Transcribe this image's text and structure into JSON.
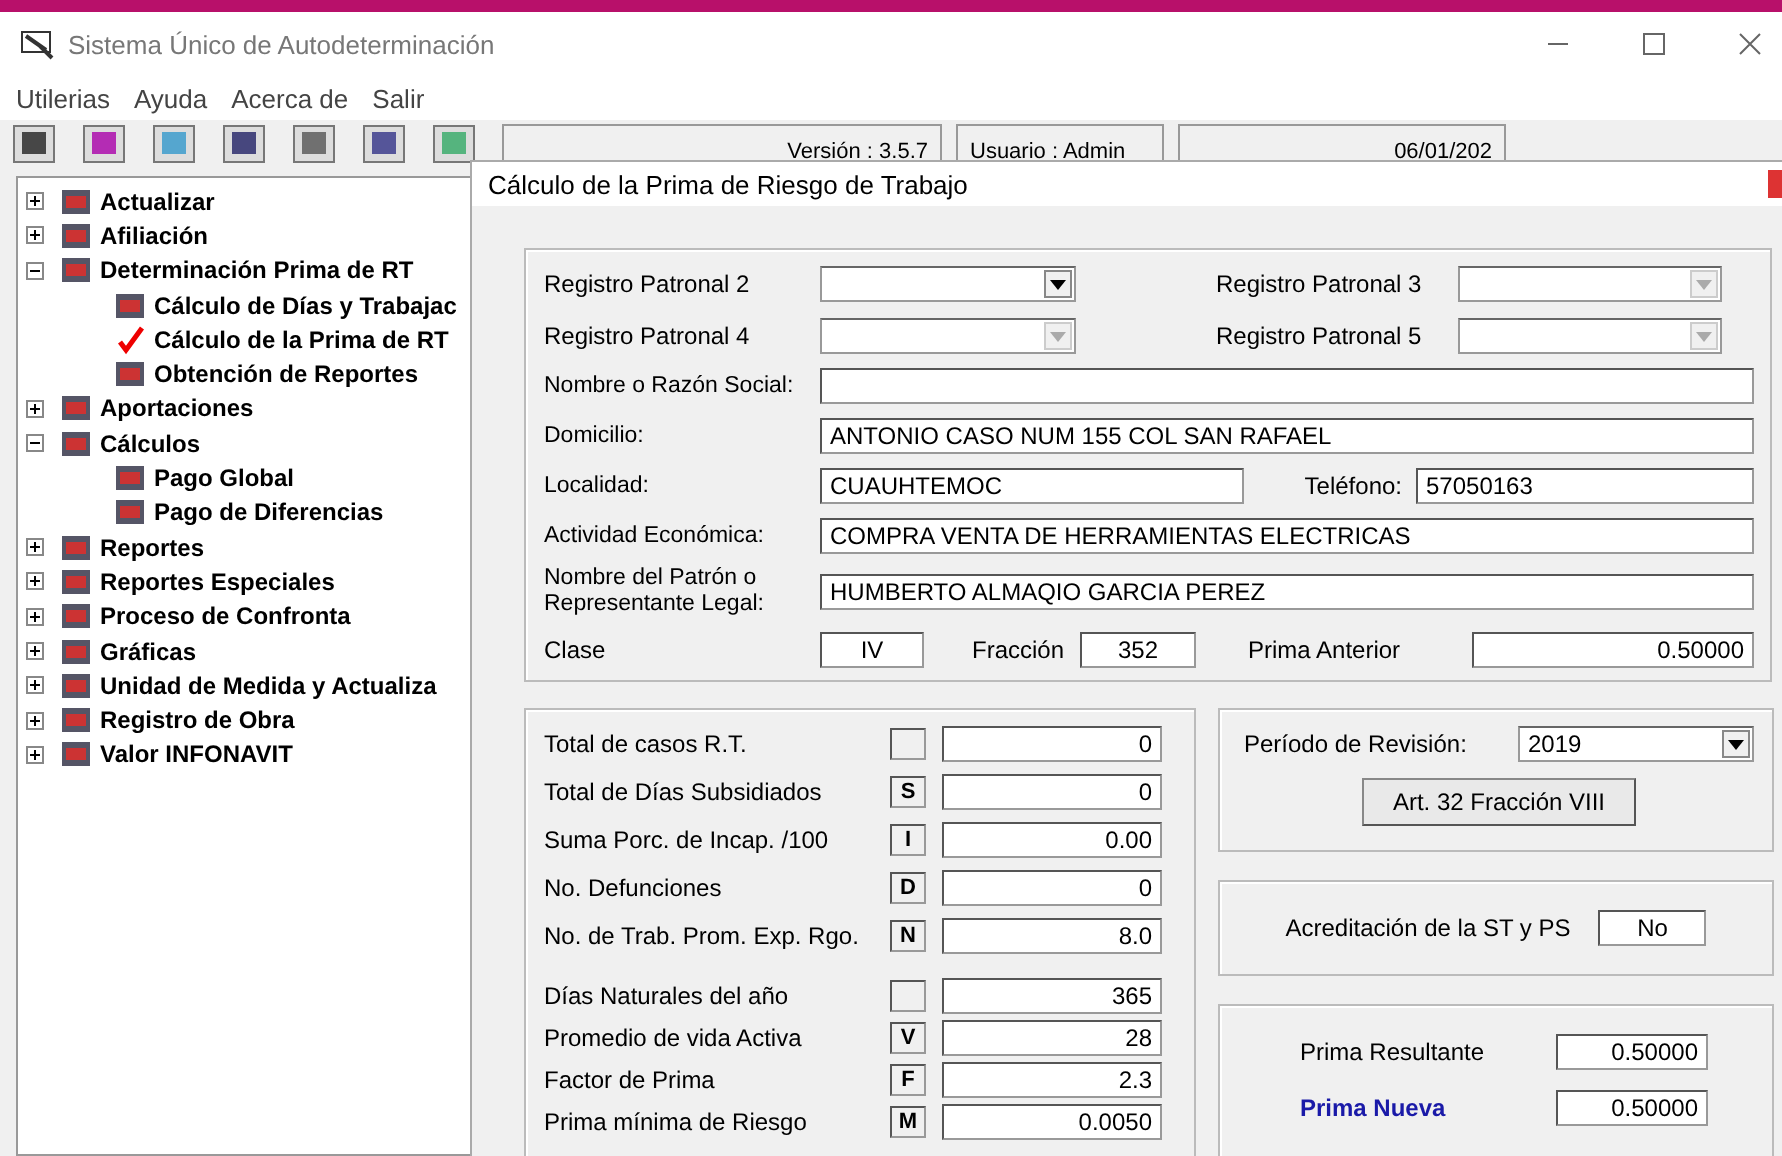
{
  "window": {
    "title": "Sistema Único de Autodeterminación"
  },
  "menu": [
    "Utilerias",
    "Ayuda",
    "Acerca de",
    "Salir"
  ],
  "status": [
    "Versión : 3.5.7",
    "Usuario : Admin",
    "06/01/202"
  ],
  "tree": [
    {
      "label": "Actualizar",
      "expanded": false
    },
    {
      "label": "Afiliación",
      "expanded": false
    },
    {
      "label": "Determinación Prima de RT",
      "expanded": true,
      "children": [
        {
          "label": "Cálculo de Días y Trabajac",
          "selected": false
        },
        {
          "label": "Cálculo de la Prima de RT",
          "selected": true
        },
        {
          "label": "Obtención de Reportes",
          "selected": false
        }
      ]
    },
    {
      "label": "Aportaciones",
      "expanded": false
    },
    {
      "label": "Cálculos",
      "expanded": true,
      "children": [
        {
          "label": "Pago Global",
          "selected": false
        },
        {
          "label": "Pago de Diferencias",
          "selected": false
        }
      ]
    },
    {
      "label": "Reportes",
      "expanded": false
    },
    {
      "label": "Reportes Especiales",
      "expanded": false
    },
    {
      "label": "Proceso de Confronta",
      "expanded": false
    },
    {
      "label": "Gráficas",
      "expanded": false
    },
    {
      "label": "Unidad de Medida y Actualiza",
      "expanded": false
    },
    {
      "label": "Registro de Obra",
      "expanded": false
    },
    {
      "label": "Valor INFONAVIT",
      "expanded": false
    }
  ],
  "dialog": {
    "title": "Cálculo de la Prima de Riesgo de Trabajo",
    "registros": [
      {
        "label": "Registro Patronal 2",
        "disabled": false
      },
      {
        "label": "Registro Patronal 3",
        "disabled": true
      },
      {
        "label": "Registro Patronal 4",
        "disabled": true
      },
      {
        "label": "Registro Patronal 5",
        "disabled": true
      }
    ],
    "nombre": {
      "label": "Nombre o Razón Social:"
    },
    "domicilio": {
      "label": "Domicilio:",
      "value": "ANTONIO CASO NUM 155 COL SAN RAFAEL"
    },
    "localidad": {
      "label": "Localidad:",
      "value": "CUAUHTEMOC"
    },
    "telefono": {
      "label": "Teléfono:",
      "value": "57050163"
    },
    "actividad": {
      "label": "Actividad Económica:",
      "value": "COMPRA VENTA DE HERRAMIENTAS ELECTRICAS"
    },
    "representante": {
      "label": "Nombre del Patrón o Representante Legal:",
      "value": "HUMBERTO ALMAQIO GARCIA PEREZ"
    },
    "clase": {
      "label": "Clase",
      "value": "IV"
    },
    "fraccion": {
      "label": "Fracción",
      "value": "352"
    },
    "prima_anterior": {
      "label": "Prima Anterior",
      "value": "0.50000"
    },
    "casos": [
      {
        "label": "Total de casos R.T.",
        "value": "0"
      },
      {
        "label": "Total de Días Subsidiados",
        "letter": "S",
        "value": "0"
      },
      {
        "label": "Suma Porc. de Incap. /100",
        "letter": "I",
        "value": "0.00"
      },
      {
        "label": "No. Defunciones",
        "letter": "D",
        "value": "0"
      },
      {
        "label": "No. de Trab. Prom. Exp. Rgo.",
        "letter": "N",
        "value": "8.0"
      }
    ],
    "factores": [
      {
        "label": "Días Naturales del año",
        "value": "365"
      },
      {
        "label": "Promedio de vida Activa",
        "letter": "V",
        "value": "28"
      },
      {
        "label": "Factor de Prima",
        "letter": "F",
        "value": "2.3"
      },
      {
        "label": "Prima mínima de Riesgo",
        "letter": "M",
        "value": "0.0050"
      }
    ],
    "periodo": {
      "label": "Período de Revisión:",
      "value": "2019"
    },
    "art_button": "Art. 32 Fracción VIII",
    "acreditacion": {
      "label": "Acreditación de la ST y PS",
      "value": "No"
    },
    "resultados": [
      {
        "label": "Prima Resultante",
        "value": "0.50000",
        "emphasized": false
      },
      {
        "label": "Prima Nueva",
        "value": "0.50000",
        "emphasized": true
      }
    ]
  }
}
